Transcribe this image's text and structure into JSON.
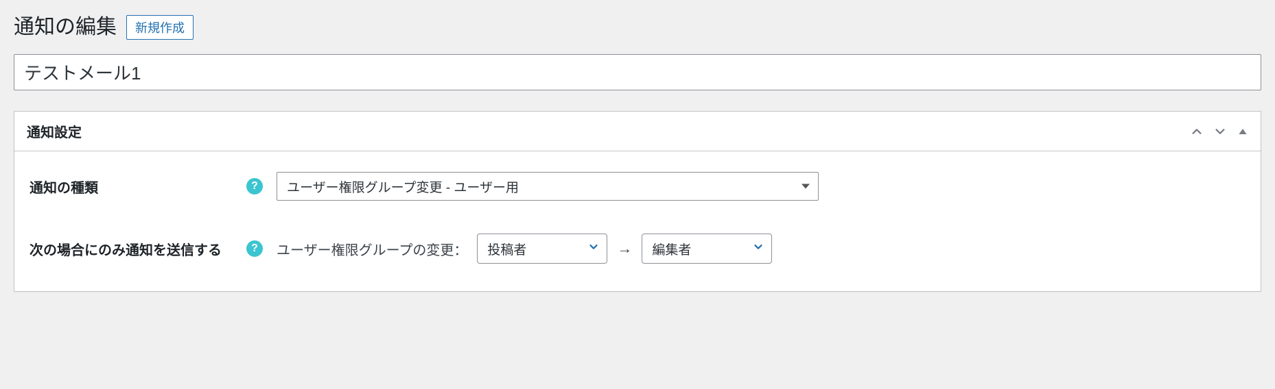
{
  "header": {
    "title": "通知の編集",
    "new_button": "新規作成"
  },
  "title_input": {
    "value": "テストメール1"
  },
  "panel": {
    "title": "通知設定",
    "fields": {
      "type": {
        "label": "通知の種類",
        "value": "ユーザー権限グループ変更 - ユーザー用"
      },
      "condition": {
        "label": "次の場合にのみ通知を送信する",
        "prefix": "ユーザー権限グループの変更：",
        "from_value": "投稿者",
        "to_value": "編集者",
        "arrow": "→"
      }
    }
  }
}
